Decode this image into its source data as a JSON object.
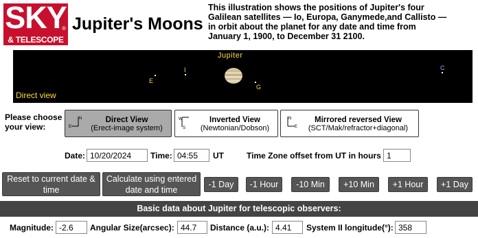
{
  "logo": {
    "brand": "SKY",
    "tagline": "& TELESCOPE",
    "registered": "®"
  },
  "page_title": "Jupiter's Moons",
  "intro": "This illustration shows the positions of Jupiter's four Galilean satellites — Io, Europa, Ganymede,and Callisto — in orbit about the planet for any date and time from January 1, 1900, to December 31 2100.",
  "sky": {
    "planet_label": "Jupiter",
    "view_label": "Direct view",
    "moons": [
      {
        "letter": "E",
        "name": "Europa"
      },
      {
        "letter": "I",
        "name": "Io"
      },
      {
        "letter": "G",
        "name": "Ganymede"
      },
      {
        "letter": "C",
        "name": "Callisto"
      }
    ],
    "colors": {
      "background": "#000000",
      "label": "#ffdd55",
      "callisto_label": "#8fa8ff"
    }
  },
  "view_choice": {
    "prompt": "Please choose your view:",
    "options": [
      {
        "title": "Direct View",
        "subtitle": "(Erect-image system)",
        "icon": "orientation-direct-icon",
        "selected": true
      },
      {
        "title": "Inverted View",
        "subtitle": "(Newtonian/Dobson)",
        "icon": "orientation-inverted-icon",
        "selected": false
      },
      {
        "title": "Mirrored reversed View",
        "subtitle": "(SCT/Mak/refractor+diagonal)",
        "icon": "orientation-mirrored-icon",
        "selected": false
      }
    ]
  },
  "datetime": {
    "date_label": "Date:",
    "date_value": "10/20/2024",
    "time_label": "Time:",
    "time_value": "04:55",
    "ut_label": "UT",
    "tz_label": "Time Zone offset from UT in hours",
    "tz_value": "1"
  },
  "actions": {
    "reset": "Reset to current date & time",
    "calculate": "Calculate using entered date and time",
    "steps": [
      "-1 Day",
      "-1 Hour",
      "-10 Min",
      "+10 Min",
      "+1 Hour",
      "+1 Day"
    ]
  },
  "data_section": {
    "heading": "Basic data about Jupiter for telescopic observers:",
    "magnitude_label": "Magnitude:",
    "magnitude_value": "-2.6",
    "size_label": "Angular Size(arcsec):",
    "size_value": "44.7",
    "distance_label": "Distance (a.u.):",
    "distance_value": "4.41",
    "longitude_label": "System II longitude(°):",
    "longitude_value": "358"
  },
  "colors": {
    "brand": "#c8102e",
    "button_dark": "#555555",
    "button_selected": "#aaaaaa",
    "data_bar": "#444444"
  }
}
